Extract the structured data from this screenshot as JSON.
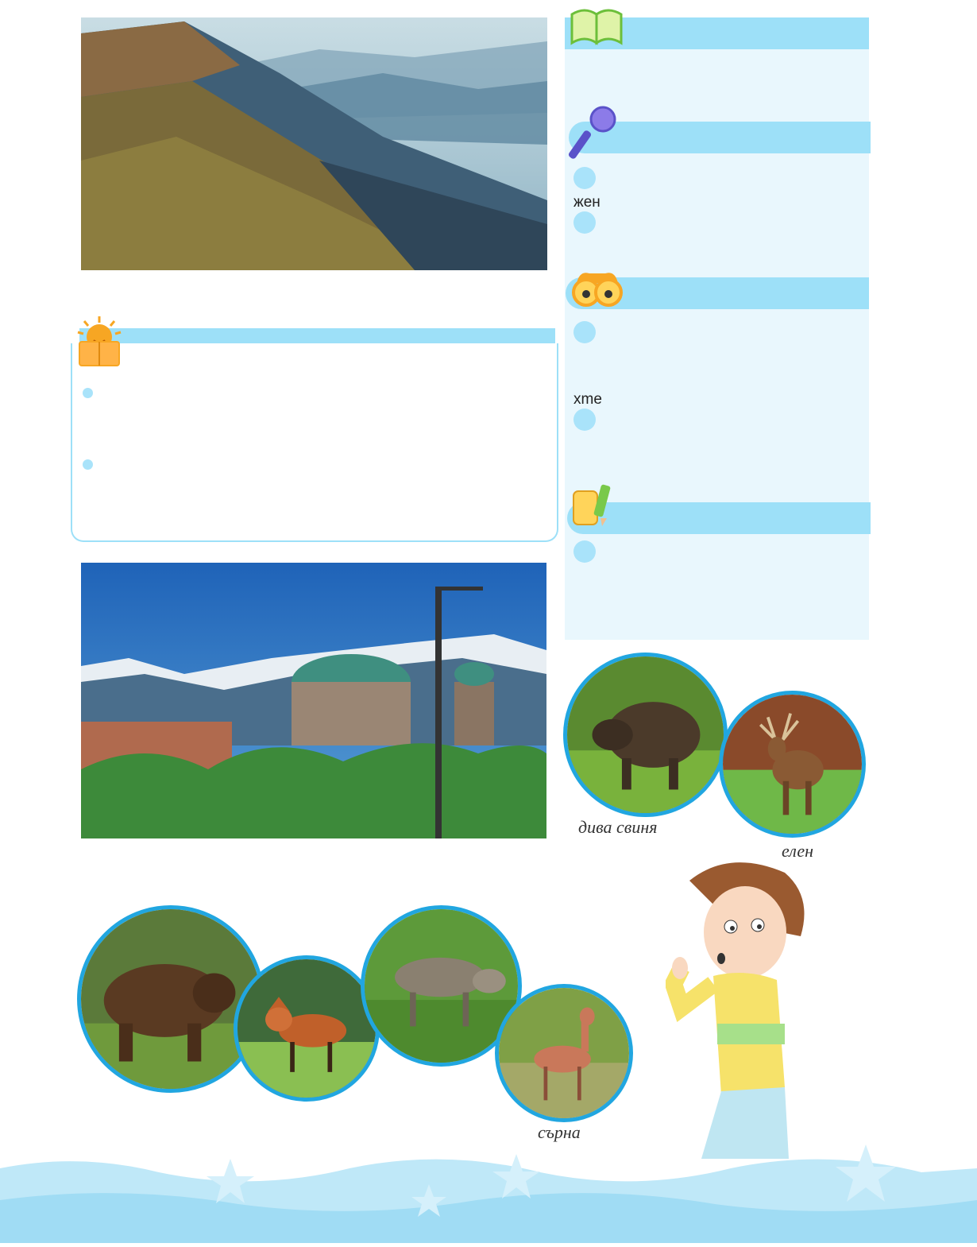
{
  "panel": {
    "speak_words": [
      "жен"
    ],
    "observe_words": [
      "xme"
    ]
  },
  "captions": {
    "boar": "дива свиня",
    "deer": "елен",
    "roe": "сърна"
  },
  "colors": {
    "accent_bar": "#9de0f8",
    "panel_bg": "#e9f7fd",
    "circle_border": "#21a6e0",
    "bullet": "#a9e3fa"
  },
  "icons": {
    "book": "open-book-icon",
    "microphone": "microphone-icon",
    "binoculars": "binoculars-icon",
    "scroll": "scroll-pencil-icon",
    "sun_reader": "sun-reading-icon"
  }
}
